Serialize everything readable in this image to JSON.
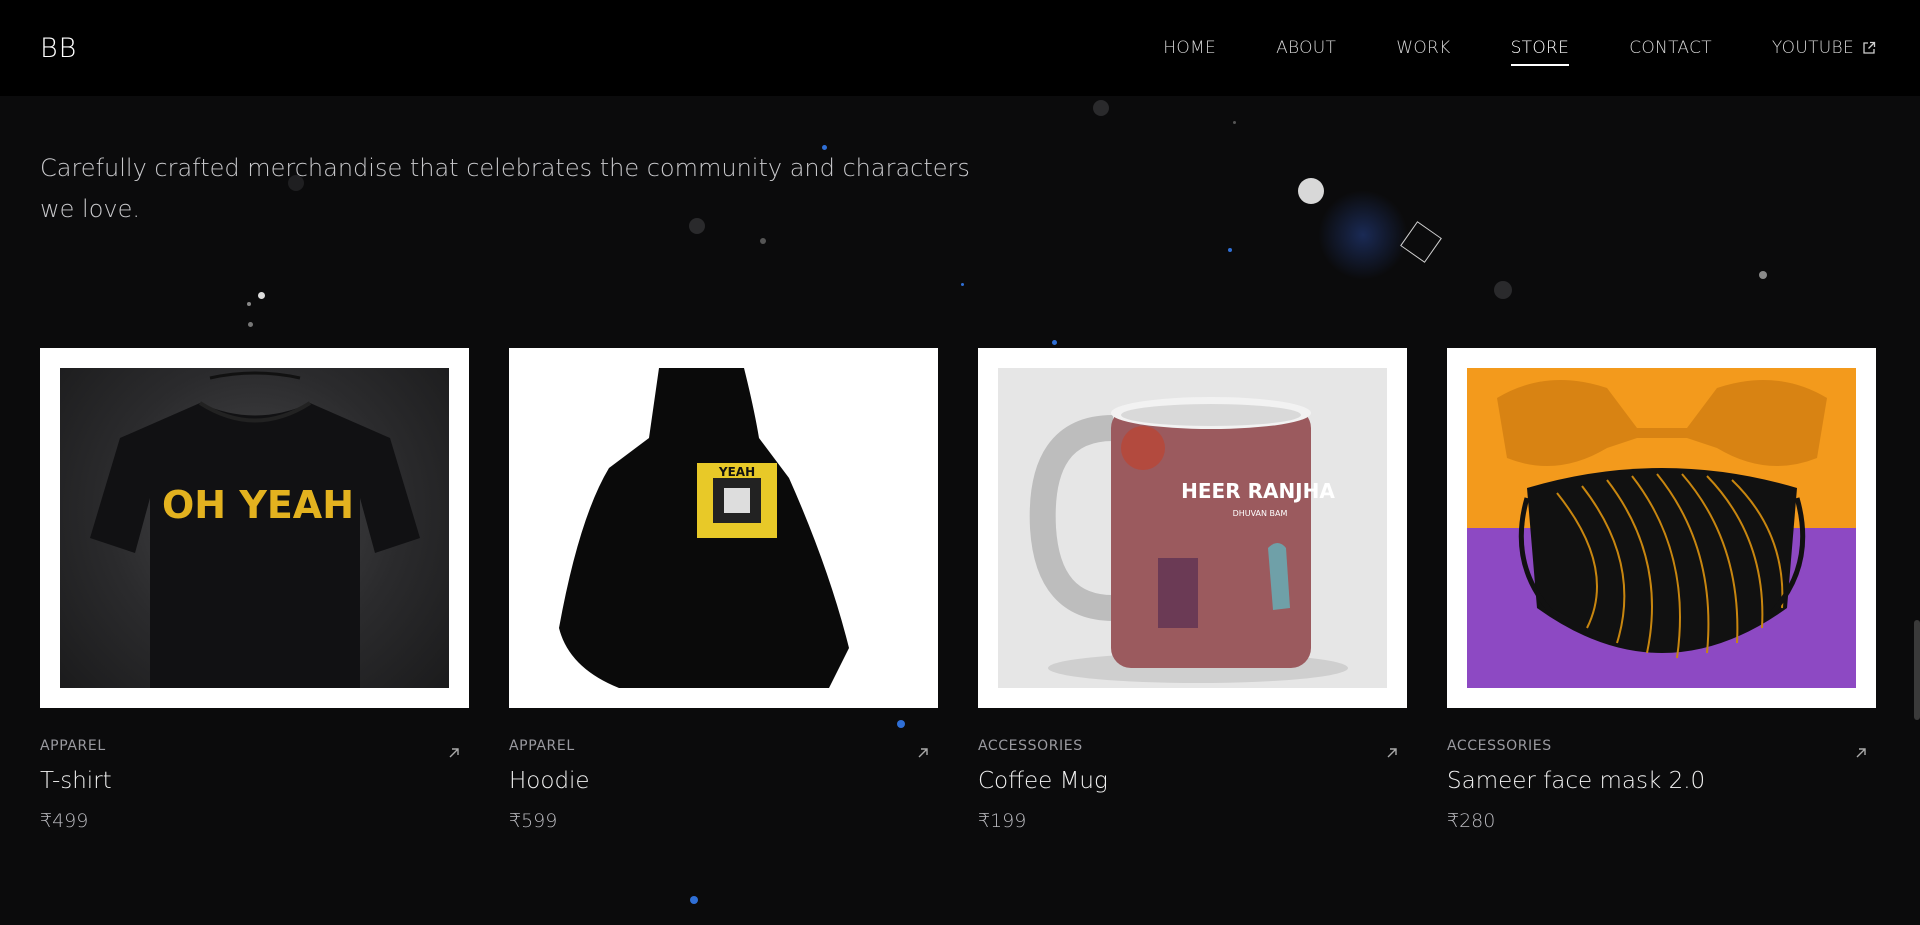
{
  "brand": {
    "logo": "BB"
  },
  "nav": {
    "items": [
      {
        "label": "HOME",
        "active": false
      },
      {
        "label": "ABOUT",
        "active": false
      },
      {
        "label": "WORK",
        "active": false
      },
      {
        "label": "STORE",
        "active": true
      },
      {
        "label": "CONTACT",
        "active": false
      },
      {
        "label": "YOUTUBE",
        "active": false,
        "icon": "external-link-icon"
      }
    ]
  },
  "intro": {
    "text": "Carefully crafted merchandise that celebrates the community and characters we love."
  },
  "products": [
    {
      "category": "APPAREL",
      "name": "T-shirt",
      "price": "₹499",
      "image_text": "OH YEAH"
    },
    {
      "category": "APPAREL",
      "name": "Hoodie",
      "price": "₹599",
      "image_text": "YEAH"
    },
    {
      "category": "ACCESSORIES",
      "name": "Coffee Mug",
      "price": "₹199",
      "image_text": "HEER RANJHA",
      "image_subtext": "DHUVAN BAM"
    },
    {
      "category": "ACCESSORIES",
      "name": "Sameer face mask 2.0",
      "price": "₹280"
    }
  ],
  "colors": {
    "background": "#0b0b0c",
    "nav_background": "#000000",
    "accent_dot": "#2f6fd6",
    "mask_orange": "#f39a1c",
    "mask_purple": "#8d49c3"
  }
}
